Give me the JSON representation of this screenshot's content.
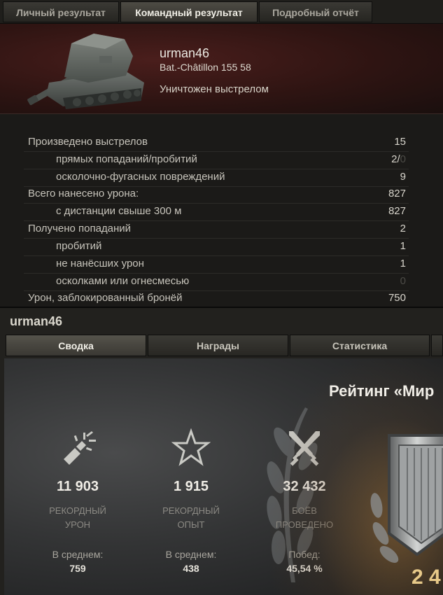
{
  "top_tabs": [
    "Личный результат",
    "Командный результат",
    "Подробный отчёт"
  ],
  "header": {
    "player_name": "urman46",
    "tank_name": "Bat.-Châtillon 155 58",
    "status": "Уничтожен выстрелом"
  },
  "stats": [
    {
      "label": "Произведено выстрелов",
      "value": "15",
      "sub": false
    },
    {
      "label": "прямых попаданий/пробитий",
      "value": "2/",
      "value_dim": "0",
      "sub": true
    },
    {
      "label": "осколочно-фугасных повреждений",
      "value": "9",
      "sub": true
    },
    {
      "label": "Всего нанесено урона:",
      "value": "827",
      "sub": false
    },
    {
      "label": "с дистанции свыше 300 м",
      "value": "827",
      "sub": true
    },
    {
      "label": "Получено попаданий",
      "value": "2",
      "sub": false
    },
    {
      "label": "пробитий",
      "value": "1",
      "sub": true
    },
    {
      "label": "не нанёсших урон",
      "value": "1",
      "sub": true
    },
    {
      "label": "осколками или огнесмесью",
      "value": "0",
      "sub": true,
      "dim": true
    },
    {
      "label": "Урон, заблокированный бронёй",
      "value": "750",
      "sub": false
    }
  ],
  "profile": {
    "title": "urman46",
    "tabs": [
      "Сводка",
      "Награды",
      "Статистика"
    ],
    "rating_title": "Рейтинг «Мир",
    "rating_value": "2 4",
    "columns": [
      {
        "icon": "shell-explosion-icon",
        "value": "11 903",
        "caption_1": "РЕКОРДНЫЙ",
        "caption_2": "УРОН",
        "avg_label": "В среднем:",
        "avg_value": "759"
      },
      {
        "icon": "star-icon",
        "value": "1 915",
        "caption_1": "РЕКОРДНЫЙ",
        "caption_2": "ОПЫТ",
        "avg_label": "В среднем:",
        "avg_value": "438"
      },
      {
        "icon": "crossed-swords-icon",
        "value": "32 432",
        "caption_1": "БОЁВ",
        "caption_2": "ПРОВЕДЕНО",
        "avg_label": "Побед:",
        "avg_value": "45,54 %"
      }
    ]
  }
}
